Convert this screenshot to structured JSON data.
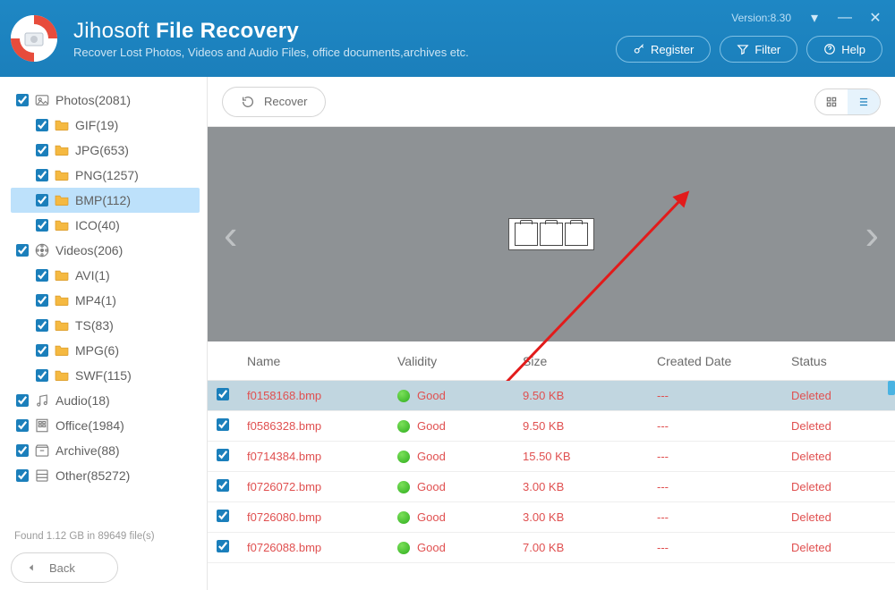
{
  "header": {
    "brand": "Jihosoft",
    "product": "File Recovery",
    "subtitle": "Recover Lost Photos, Videos and Audio Files, office documents,archives etc.",
    "version": "Version:8.30",
    "actions": {
      "register": "Register",
      "filter": "Filter",
      "help": "Help"
    }
  },
  "sidebar": {
    "categories": [
      {
        "name": "Photos",
        "count": 2081,
        "kind": "photos",
        "children": [
          {
            "name": "GIF",
            "count": 19
          },
          {
            "name": "JPG",
            "count": 653
          },
          {
            "name": "PNG",
            "count": 1257
          },
          {
            "name": "BMP",
            "count": 112,
            "selected": true
          },
          {
            "name": "ICO",
            "count": 40
          }
        ]
      },
      {
        "name": "Videos",
        "count": 206,
        "kind": "videos",
        "children": [
          {
            "name": "AVI",
            "count": 1
          },
          {
            "name": "MP4",
            "count": 1
          },
          {
            "name": "TS",
            "count": 83
          },
          {
            "name": "MPG",
            "count": 6
          },
          {
            "name": "SWF",
            "count": 115
          }
        ]
      },
      {
        "name": "Audio",
        "count": 18,
        "kind": "audio"
      },
      {
        "name": "Office",
        "count": 1984,
        "kind": "office"
      },
      {
        "name": "Archive",
        "count": 88,
        "kind": "archive"
      },
      {
        "name": "Other",
        "count": 85272,
        "kind": "other"
      }
    ],
    "found": "Found 1.12 GB in 89649 file(s)",
    "back": "Back"
  },
  "toolbar": {
    "recover": "Recover"
  },
  "table": {
    "headers": {
      "name": "Name",
      "validity": "Validity",
      "size": "Size",
      "created": "Created Date",
      "status": "Status"
    },
    "rows": [
      {
        "name": "f0158168.bmp",
        "validity": "Good",
        "size": "9.50 KB",
        "date": "---",
        "status": "Deleted",
        "selected": true
      },
      {
        "name": "f0586328.bmp",
        "validity": "Good",
        "size": "9.50 KB",
        "date": "---",
        "status": "Deleted"
      },
      {
        "name": "f0714384.bmp",
        "validity": "Good",
        "size": "15.50 KB",
        "date": "---",
        "status": "Deleted"
      },
      {
        "name": "f0726072.bmp",
        "validity": "Good",
        "size": "3.00 KB",
        "date": "---",
        "status": "Deleted"
      },
      {
        "name": "f0726080.bmp",
        "validity": "Good",
        "size": "3.00 KB",
        "date": "---",
        "status": "Deleted"
      },
      {
        "name": "f0726088.bmp",
        "validity": "Good",
        "size": "7.00 KB",
        "date": "---",
        "status": "Deleted"
      }
    ]
  }
}
